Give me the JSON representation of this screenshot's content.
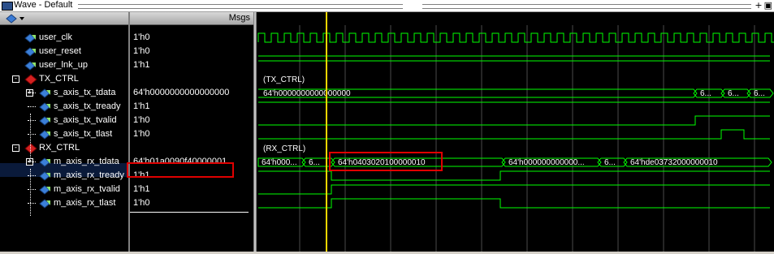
{
  "window": {
    "title": "Wave - Default"
  },
  "header": {
    "msgs_label": "Msgs"
  },
  "signals": [
    {
      "name": "user_clk",
      "value": "1'h0",
      "indent": 1,
      "kind": "signal"
    },
    {
      "name": "user_reset",
      "value": "1'h0",
      "indent": 1,
      "kind": "signal"
    },
    {
      "name": "user_lnk_up",
      "value": "1'h1",
      "indent": 1,
      "kind": "signal"
    },
    {
      "name": "TX_CTRL",
      "value": "",
      "indent": 0,
      "kind": "group"
    },
    {
      "name": "s_axis_tx_tdata",
      "value": "64'h0000000000000000",
      "indent": 2,
      "kind": "bus"
    },
    {
      "name": "s_axis_tx_tready",
      "value": "1'h1",
      "indent": 2,
      "kind": "signal"
    },
    {
      "name": "s_axis_tx_tvalid",
      "value": "1'h0",
      "indent": 2,
      "kind": "signal"
    },
    {
      "name": "s_axis_tx_tlast",
      "value": "1'h0",
      "indent": 2,
      "kind": "signal"
    },
    {
      "name": "RX_CTRL",
      "value": "",
      "indent": 0,
      "kind": "group"
    },
    {
      "name": "m_axis_rx_tdata",
      "value": "64'h01a0090f40000001",
      "indent": 2,
      "kind": "bus"
    },
    {
      "name": "m_axis_rx_tready",
      "value": "1'h1",
      "indent": 2,
      "kind": "signal"
    },
    {
      "name": "m_axis_rx_tvalid",
      "value": "1'h1",
      "indent": 2,
      "kind": "signal"
    },
    {
      "name": "m_axis_rx_tlast",
      "value": "1'h0",
      "indent": 2,
      "kind": "signal"
    }
  ],
  "wave_labels": {
    "tx_group": "(TX_CTRL)",
    "rx_group": "(RX_CTRL)",
    "tx_tdata_first": "64'h0000000000000000",
    "tx_tdata_s1": "6...",
    "tx_tdata_s2": "6...",
    "tx_tdata_s3": "6...",
    "rx_tdata_s0": "64'h000...",
    "rx_tdata_s1": "6...",
    "rx_tdata_s2": "64'h0403020100000010",
    "rx_tdata_s3": "64'h000000000000...",
    "rx_tdata_s4": "6...",
    "rx_tdata_s5": "64'hde03732000000010"
  },
  "colors": {
    "wave": "#00ff00",
    "cursor": "#ffd700",
    "highlight": "#e00000",
    "grid": "#4a4a4a"
  },
  "icons": [
    "wave-window-icon",
    "signal-icon",
    "group-diamond-icon"
  ]
}
